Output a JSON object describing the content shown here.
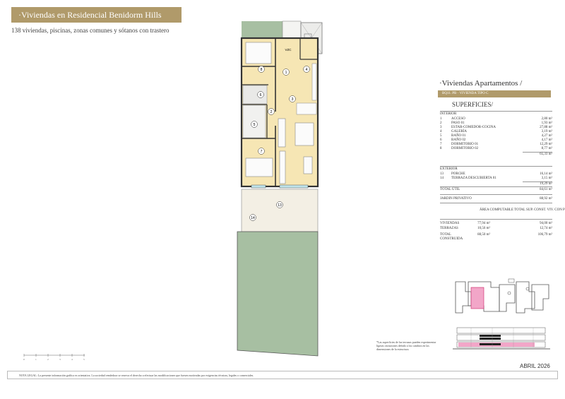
{
  "header": {
    "title": "·Viviendas en Residencial Benidorm Hills",
    "subtitle": "138 viviendas, piscinas, zonas comunes y sótanos con trastero"
  },
  "section": {
    "title": "·Viviendas Apartamentos /",
    "unit_label": "BQ11. PB · VIVIENDA TIPO C",
    "superficies_title": "SUPERFICIES/"
  },
  "interior": {
    "heading": "INTERIOR",
    "rows": [
      {
        "n": "1",
        "label": "ACCESO",
        "value": "2,80 m²"
      },
      {
        "n": "2",
        "label": "PASO 01",
        "value": "1,93 m²"
      },
      {
        "n": "3",
        "label": "ESTAR-COMEDOR-COCINA",
        "value": "27,88 m²"
      },
      {
        "n": "4",
        "label": "GALERÍA",
        "value": "3,19 m²"
      },
      {
        "n": "5",
        "label": "BAÑO 01",
        "value": "4,27 m²"
      },
      {
        "n": "6",
        "label": "BAÑO 02",
        "value": "4,17 m²"
      },
      {
        "n": "7",
        "label": "DORMITORIO 01",
        "value": "12,29 m²"
      },
      {
        "n": "8",
        "label": "DORMITORIO 02",
        "value": "8,77 m²"
      }
    ],
    "subtotal": "65,33 m²"
  },
  "exterior": {
    "heading": "EXTERIOR",
    "rows": [
      {
        "n": "13",
        "label": "PORCHE",
        "value": "16,14 m²"
      },
      {
        "n": "14",
        "label": "TERRAZA DESCUBIERTA 01",
        "value": "3,15 m²"
      }
    ],
    "subtotal": "19,29 m²"
  },
  "totals": {
    "total_util_label": "TOTAL ÚTIL",
    "total_util_value": "84,61 m²",
    "jardin_label": "JARDIN PRIVATIVO",
    "jardin_value": "88,92 m²"
  },
  "summary": {
    "col1_header": "ÁREA COMPUTABLE",
    "col2_header": "TOTAL SUP. CONST. VIV. CON P/P Z.C",
    "rows": [
      {
        "label": "VIVIENDAS",
        "a": "77,94 m²",
        "b": "94,00 m²"
      },
      {
        "label": "TERRAZAS",
        "a": "10,56 m²",
        "b": "12,74 m²"
      },
      {
        "label": "TOTAL CONSTRUIDA",
        "a": "88,50 m²",
        "b": "106,79 m²"
      }
    ]
  },
  "plan_labels": {
    "r1": "1",
    "r2": "2",
    "r3": "3",
    "r4": "4",
    "r5": "5",
    "r6": "6",
    "r7": "7",
    "r8": "8",
    "r13": "13",
    "r14": "14",
    "vzc": "VZC"
  },
  "scale_ticks": [
    "0",
    "1",
    "2",
    "3",
    "4",
    "5"
  ],
  "footnote": "*Las superficies de las terrazas pueden experimentar ligeras variaciones debido a los cambios en las dimensiones de la estructura.",
  "date": "ABRIL 2026",
  "legal": "NOTA LEGAL: La presente información gráfica es orientativa. La sociedad vendedora se reserva el derecho a efectuar las modificaciones que fuesen motivadas por exigencias técnicas, legales o comerciales.",
  "colors": {
    "gold": "#b09a6a",
    "room_fill": "#f6e6b4",
    "garden": "#a7bfa2",
    "porch": "#f3efe4",
    "highlight": "#f2a6c8"
  }
}
